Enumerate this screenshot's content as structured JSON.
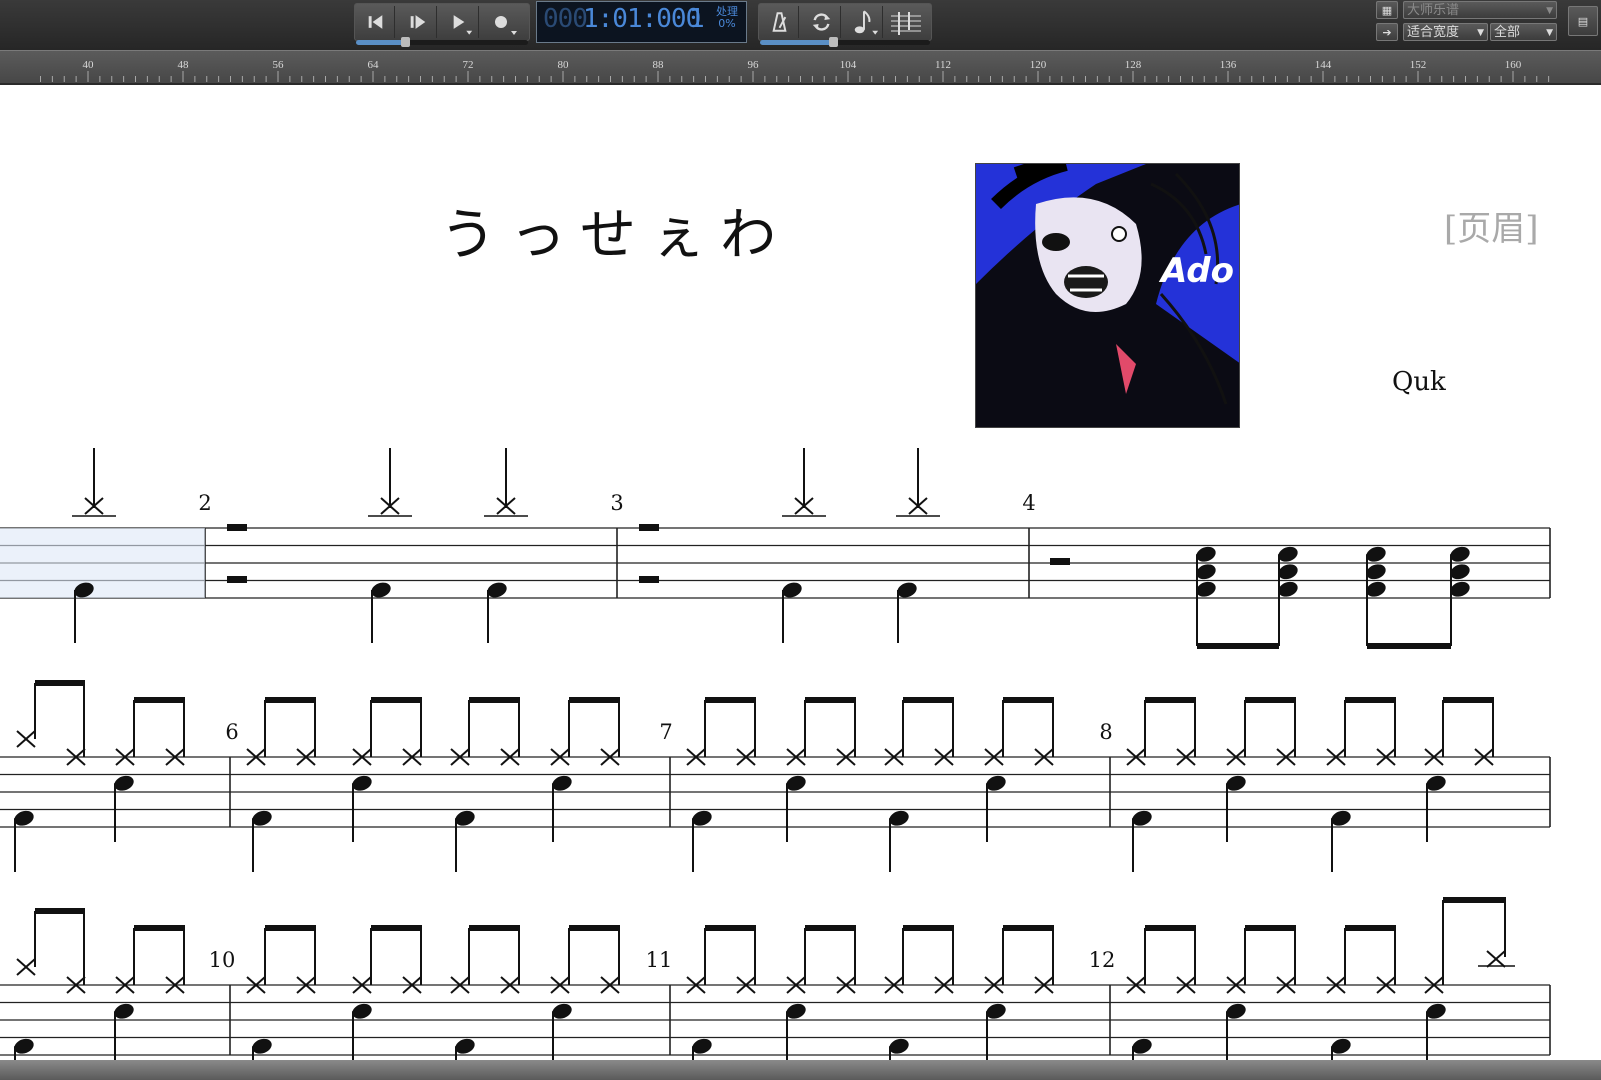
{
  "toolbar": {
    "rewind_icon": "rewind-icon",
    "step_icon": "step-forward-icon",
    "play_icon": "play-icon",
    "record_icon": "record-icon",
    "counter_dim": "000",
    "counter": "1:01:000",
    "bar_display": "1",
    "processing_label": "处理",
    "processing_value": "0%",
    "metronome_icon": "metronome-icon",
    "loop_icon": "loop-icon",
    "note_icon": "note-input-icon",
    "staff_icon": "staff-view-icon",
    "score_style_select": "大师乐谱",
    "fit_select": "适合宽度",
    "range_select": "全部",
    "playback_slider_fraction": 0.28,
    "tempo_slider_fraction": 0.43
  },
  "ruler": {
    "ticks": [
      "40",
      "48",
      "56",
      "64",
      "72",
      "80",
      "88",
      "96",
      "104",
      "112",
      "120",
      "128",
      "136",
      "144",
      "152",
      "160"
    ]
  },
  "score": {
    "title": "うっせぇわ",
    "header_placeholder": "[页眉]",
    "composer": "Quk",
    "cover_text": "Ado",
    "measure_numbers": [
      "2",
      "3",
      "4",
      "6",
      "7",
      "8",
      "10",
      "11",
      "12"
    ]
  }
}
